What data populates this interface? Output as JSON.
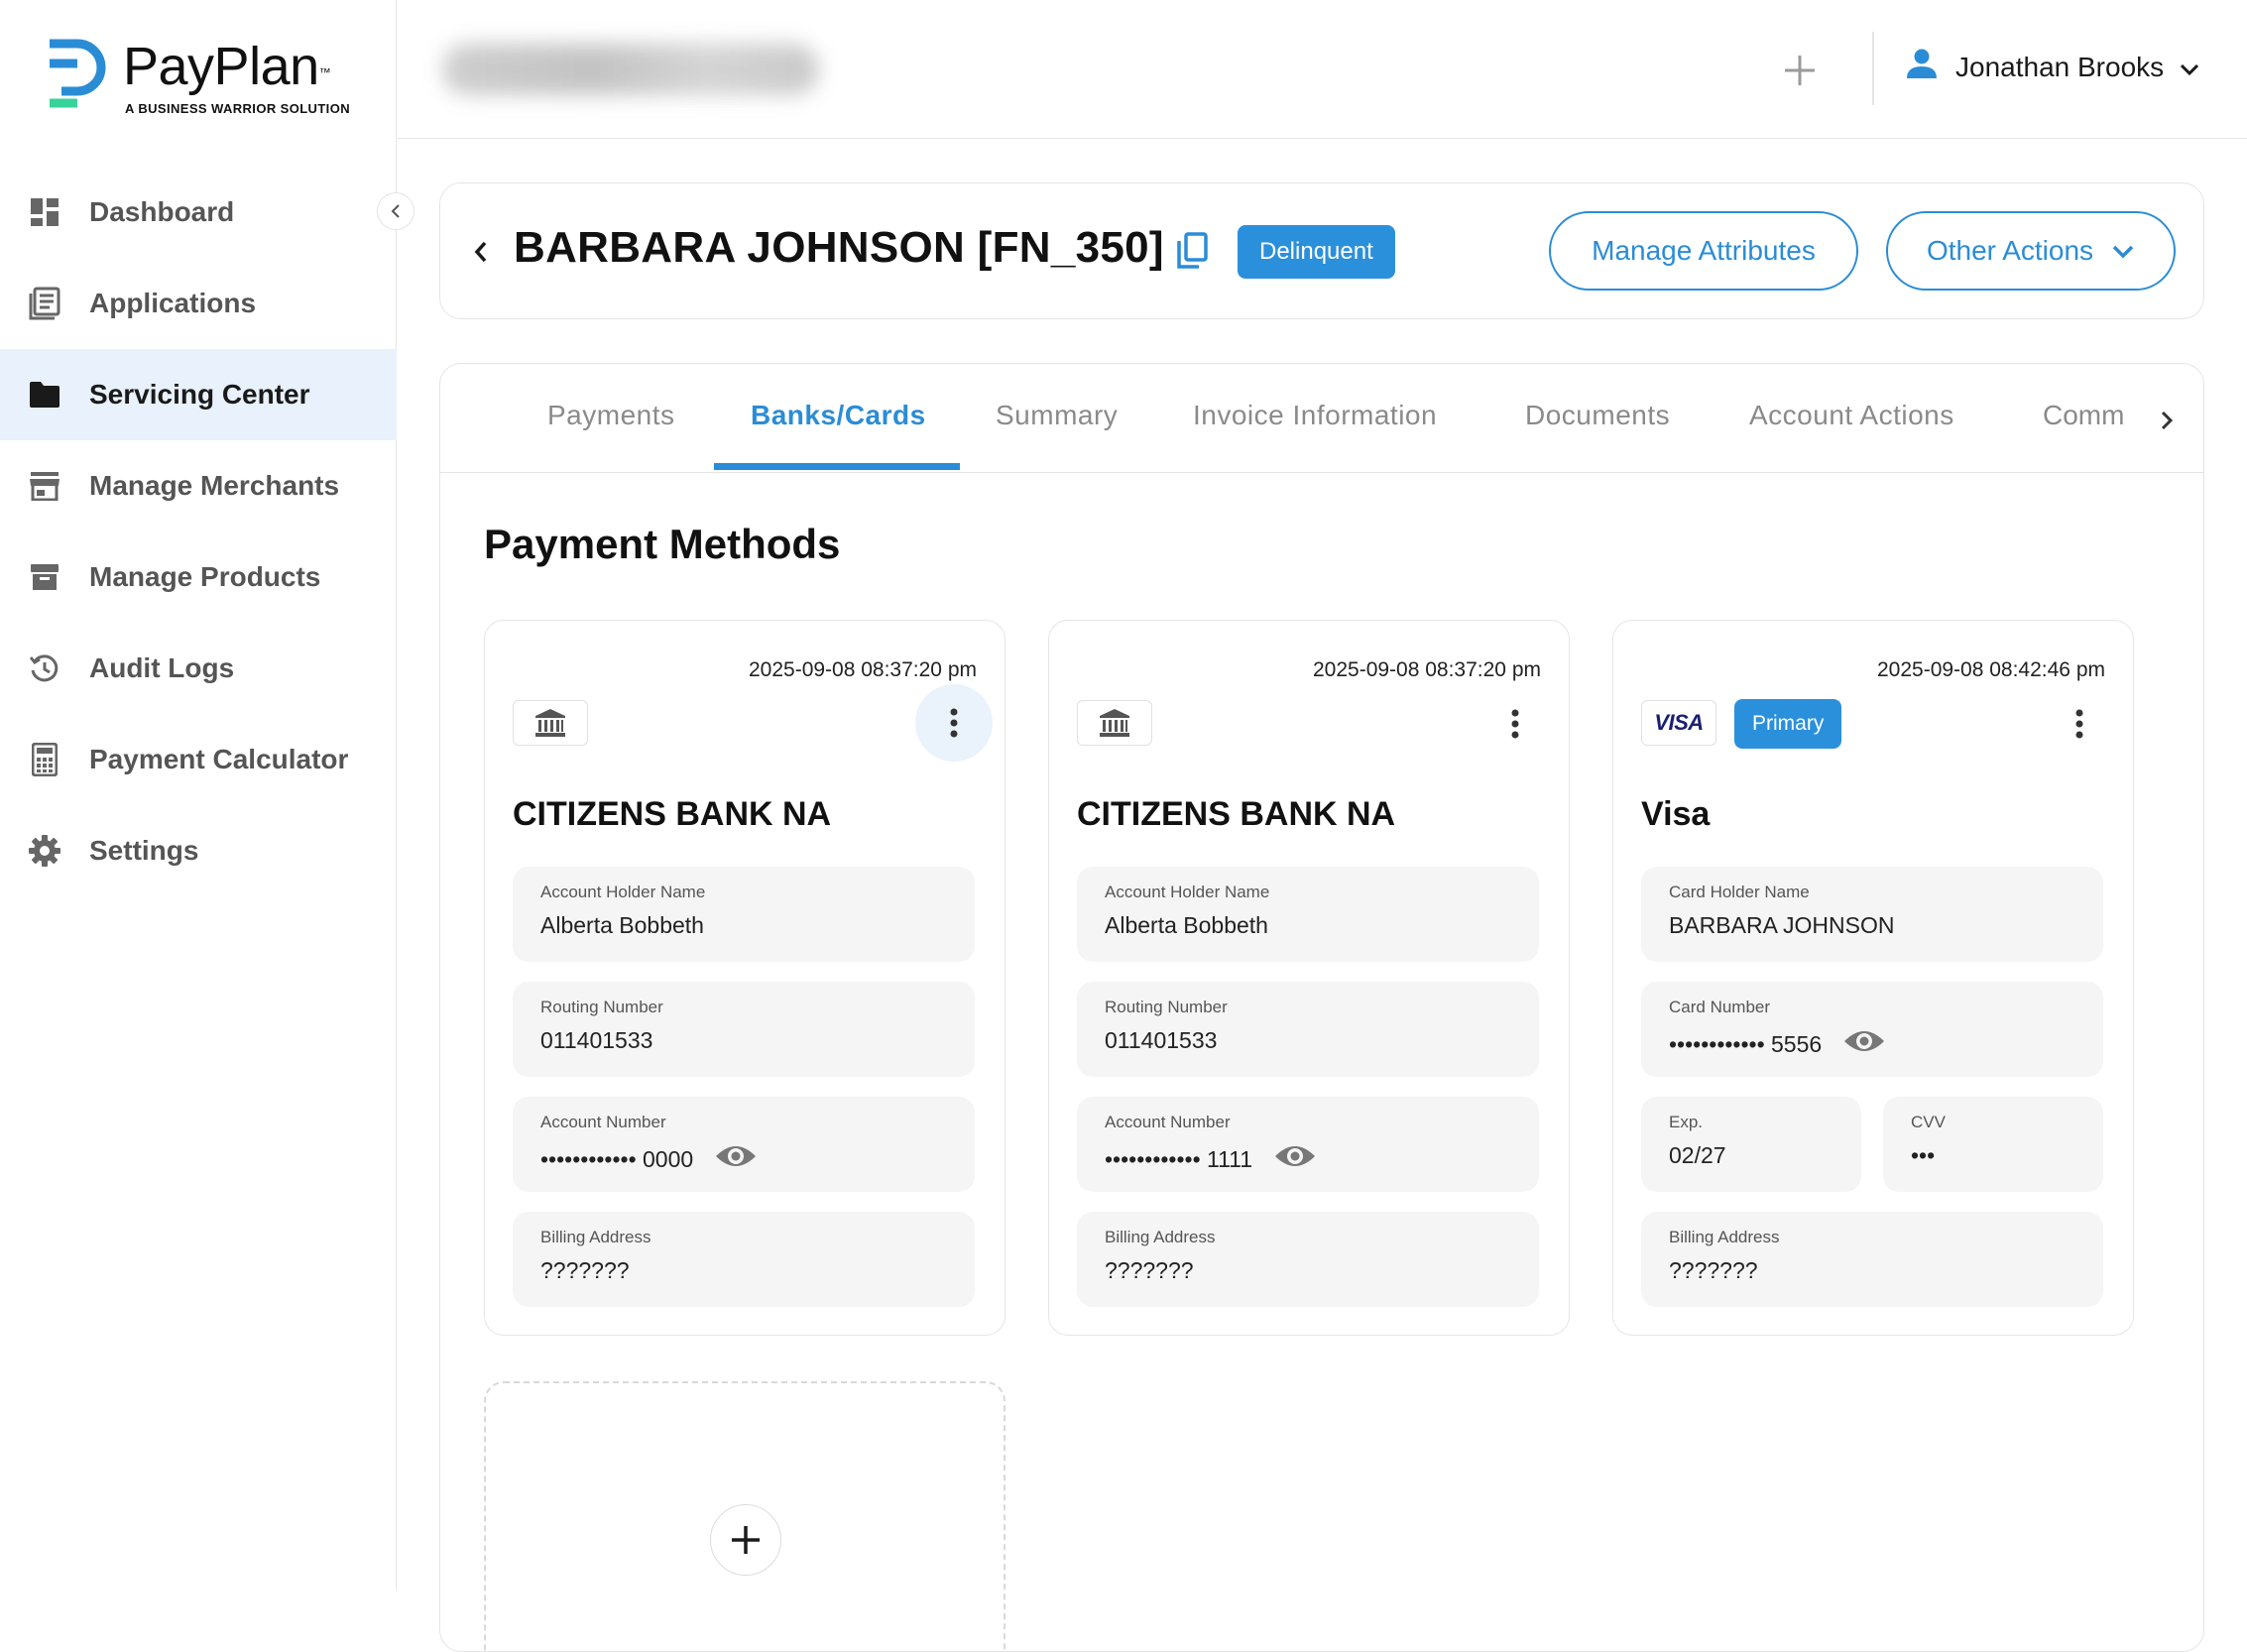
{
  "brand": {
    "name": "PayPlan",
    "trademark": "™",
    "tagline": "A BUSINESS WARRIOR SOLUTION",
    "colors": {
      "blue": "#2b8cd6",
      "green": "#37d39a",
      "accent_bg": "#e8f1fc"
    }
  },
  "sidebar": {
    "items": [
      {
        "label": "Dashboard",
        "icon": "dashboard-icon",
        "active": false
      },
      {
        "label": "Applications",
        "icon": "applications-icon",
        "active": false
      },
      {
        "label": "Servicing Center",
        "icon": "folder-icon",
        "active": true
      },
      {
        "label": "Manage Merchants",
        "icon": "store-icon",
        "active": false
      },
      {
        "label": "Manage Products",
        "icon": "archive-icon",
        "active": false
      },
      {
        "label": "Audit Logs",
        "icon": "history-icon",
        "active": false
      },
      {
        "label": "Payment Calculator",
        "icon": "calculator-icon",
        "active": false
      },
      {
        "label": "Settings",
        "icon": "gear-icon",
        "active": false
      }
    ]
  },
  "topbar": {
    "user_name": "Jonathan Brooks"
  },
  "header": {
    "client_name": "BARBARA JOHNSON [FN_350]",
    "status": "Delinquent",
    "manage_attributes": "Manage Attributes",
    "other_actions": "Other Actions"
  },
  "tabs": {
    "items": [
      "Payments",
      "Banks/Cards",
      "Summary",
      "Invoice Information",
      "Documents",
      "Account Actions",
      "Comm"
    ],
    "active": "Banks/Cards"
  },
  "payment_methods": {
    "title": "Payment Methods",
    "cards": [
      {
        "date": "2025-09-08 08:37:20 pm",
        "type": "bank",
        "name": "CITIZENS BANK NA",
        "holder_label": "Account Holder Name",
        "holder": "Alberta Bobbeth",
        "routing_label": "Routing Number",
        "routing": "011401533",
        "account_label": "Account Number",
        "account": "•••••••••••• 0000",
        "billing_label": "Billing Address",
        "billing": "???????"
      },
      {
        "date": "2025-09-08 08:37:20 pm",
        "type": "bank",
        "name": "CITIZENS BANK NA",
        "holder_label": "Account Holder Name",
        "holder": "Alberta Bobbeth",
        "routing_label": "Routing Number",
        "routing": "011401533",
        "account_label": "Account Number",
        "account": "•••••••••••• 1111",
        "billing_label": "Billing Address",
        "billing": "???????"
      },
      {
        "date": "2025-09-08 08:42:46 pm",
        "type": "card",
        "brand_logo": "VISA",
        "badge": "Primary",
        "name": "Visa",
        "holder_label": "Card Holder Name",
        "holder": "BARBARA JOHNSON",
        "number_label": "Card Number",
        "number": "•••••••••••• 5556",
        "exp_label": "Exp.",
        "exp": "02/27",
        "cvv_label": "CVV",
        "cvv": "•••",
        "billing_label": "Billing Address",
        "billing": "???????"
      }
    ]
  }
}
